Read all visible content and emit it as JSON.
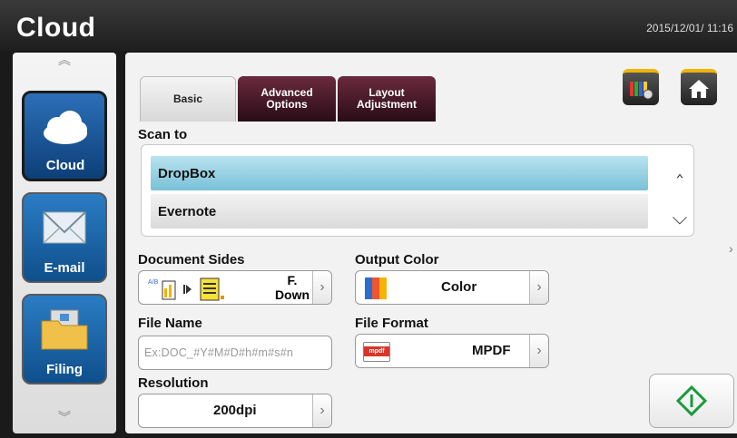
{
  "header": {
    "title": "Cloud",
    "datetime": "2015/12/01/ 11:16"
  },
  "sidebar": {
    "items": [
      {
        "label": "Cloud",
        "icon": "cloud-icon"
      },
      {
        "label": "E-mail",
        "icon": "envelope-icon"
      },
      {
        "label": "Filing",
        "icon": "folder-icon"
      }
    ]
  },
  "tabs": [
    {
      "label": "Basic",
      "active": true
    },
    {
      "label": "Advanced Options",
      "line1": "Advanced",
      "line2": "Options",
      "active": false
    },
    {
      "label": "Layout Adjustment",
      "line1": "Layout",
      "line2": "Adjustment",
      "active": false
    }
  ],
  "toolbar": {
    "settings_icon": "color-settings-icon",
    "home_icon": "home-icon"
  },
  "scan_to": {
    "label": "Scan to",
    "items": [
      "DropBox",
      "Evernote"
    ],
    "selected": "DropBox"
  },
  "document_sides": {
    "label": "Document Sides",
    "value_line1": "F.",
    "value_line2": "Down"
  },
  "output_color": {
    "label": "Output Color",
    "value": "Color"
  },
  "file_name": {
    "label": "File Name",
    "placeholder": "Ex:DOC_#Y#M#D#h#m#s#n"
  },
  "file_format": {
    "label": "File Format",
    "value": "MPDF",
    "badge": "mpdf"
  },
  "resolution": {
    "label": "Resolution",
    "value": "200dpi"
  },
  "start_button": {
    "icon": "start-scan-icon"
  },
  "colors": {
    "accent_green": "#1a9a3c",
    "selected_row": "#8ccbe0",
    "tab_inactive": "#4a1828",
    "sidebar_blue": "#1a5fa3"
  }
}
